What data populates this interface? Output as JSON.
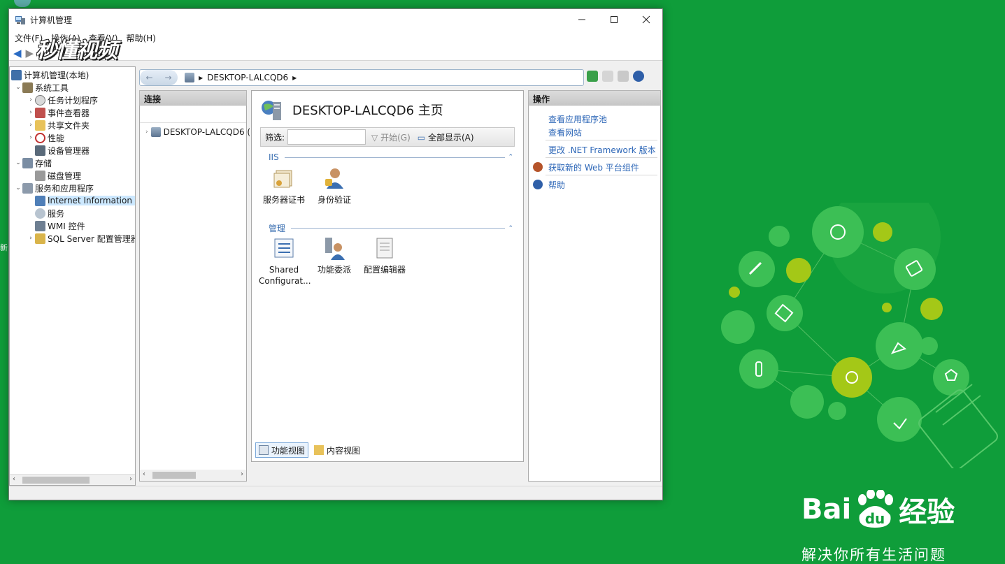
{
  "desktop": {
    "side_text": "新"
  },
  "window": {
    "title": "计算机管理",
    "menu": [
      "文件(F)",
      "操作(A)",
      "查看(V)",
      "帮助(H)"
    ]
  },
  "watermark": "秒懂视频",
  "tree": {
    "items": [
      {
        "label": "计算机管理(本地)",
        "icon": "computer-management-icon",
        "level": 0,
        "expander": ""
      },
      {
        "label": "系统工具",
        "icon": "tools-icon",
        "level": 1,
        "expander": "⌄"
      },
      {
        "label": "任务计划程序",
        "icon": "clock-icon",
        "level": 2,
        "expander": "›"
      },
      {
        "label": "事件查看器",
        "icon": "event-viewer-icon",
        "level": 2,
        "expander": "›"
      },
      {
        "label": "共享文件夹",
        "icon": "shared-folder-icon",
        "level": 2,
        "expander": "›"
      },
      {
        "label": "性能",
        "icon": "performance-icon",
        "level": 2,
        "expander": "›"
      },
      {
        "label": "设备管理器",
        "icon": "device-manager-icon",
        "level": 2,
        "expander": ""
      },
      {
        "label": "存储",
        "icon": "storage-icon",
        "level": 1,
        "expander": "⌄"
      },
      {
        "label": "磁盘管理",
        "icon": "disk-icon",
        "level": 2,
        "expander": ""
      },
      {
        "label": "服务和应用程序",
        "icon": "services-apps-icon",
        "level": 1,
        "expander": "⌄"
      },
      {
        "label": "Internet Information Se",
        "icon": "iis-icon",
        "level": 2,
        "expander": "",
        "selected": true
      },
      {
        "label": "服务",
        "icon": "services-icon",
        "level": 2,
        "expander": ""
      },
      {
        "label": "WMI 控件",
        "icon": "wmi-icon",
        "level": 2,
        "expander": ""
      },
      {
        "label": "SQL Server 配置管理器",
        "icon": "sql-server-icon",
        "level": 2,
        "expander": "›"
      }
    ]
  },
  "address": {
    "path": "DESKTOP-LALCQD6"
  },
  "connections": {
    "header": "连接",
    "node": "DESKTOP-LALCQD6 ("
  },
  "content": {
    "title": "DESKTOP-LALCQD6 主页",
    "filter_label": "筛选:",
    "start_label": "开始(G)",
    "show_all_label": "全部显示(A)",
    "groups": [
      {
        "name": "IIS",
        "features": [
          {
            "label": "服务器证书",
            "icon": "server-certificate-icon"
          },
          {
            "label": "身份验证",
            "icon": "authentication-icon"
          }
        ]
      },
      {
        "name": "管理",
        "features": [
          {
            "label": "Shared Configurat...",
            "icon": "shared-configuration-icon"
          },
          {
            "label": "功能委派",
            "icon": "feature-delegation-icon"
          },
          {
            "label": "配置编辑器",
            "icon": "configuration-editor-icon"
          }
        ]
      }
    ],
    "view_tabs": [
      "功能视图",
      "内容视图"
    ]
  },
  "actions": {
    "header": "操作",
    "items": [
      "查看应用程序池",
      "查看网站",
      "更改 .NET Framework 版本",
      "获取新的 Web 平台组件",
      "帮助"
    ]
  },
  "brand": {
    "logo_left": "Bai",
    "logo_mid": "du",
    "logo_right": "经验",
    "slogan": "解决你所有生活问题"
  },
  "colors": {
    "background": "#0f9d3a",
    "link": "#2c66b7",
    "group": "#3b6fb1"
  }
}
